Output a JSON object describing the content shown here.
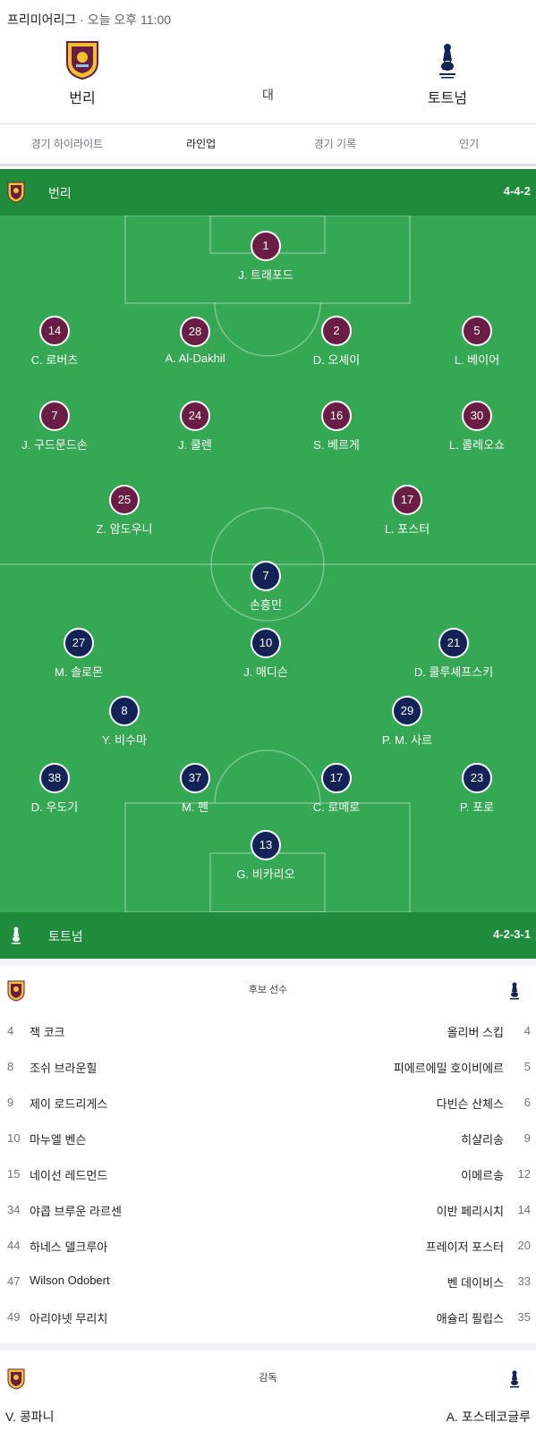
{
  "header": {
    "league": "프리미어리그",
    "time": "· 오늘 오후 11:00",
    "home_team": "번리",
    "away_team": "토트넘",
    "vs": "대"
  },
  "tabs": [
    {
      "label": "경기 하이라이트",
      "active": false
    },
    {
      "label": "라인업",
      "active": true
    },
    {
      "label": "경기 기록",
      "active": false
    },
    {
      "label": "인기",
      "active": false
    }
  ],
  "colors": {
    "pitch": "#34a852",
    "team_bar": "#1e8c3a",
    "home_kit": "#6c1d45",
    "away_kit": "#132257"
  },
  "home_lineup": {
    "team": "번리",
    "formation": "4-4-2",
    "players": [
      {
        "num": "1",
        "name": "J. 트래포드"
      },
      {
        "num": "14",
        "name": "C. 로버츠"
      },
      {
        "num": "28",
        "name": "A. Al-Dakhil"
      },
      {
        "num": "2",
        "name": "D. 오셰이"
      },
      {
        "num": "5",
        "name": "L. 베이어"
      },
      {
        "num": "7",
        "name": "J. 구드문드손"
      },
      {
        "num": "24",
        "name": "J. 쿨렌"
      },
      {
        "num": "16",
        "name": "S. 베르게"
      },
      {
        "num": "30",
        "name": "L. 콜레오쇼"
      },
      {
        "num": "25",
        "name": "Z. 암도우니"
      },
      {
        "num": "17",
        "name": "L. 포스터"
      }
    ]
  },
  "away_lineup": {
    "team": "토트넘",
    "formation": "4-2-3-1",
    "players": [
      {
        "num": "7",
        "name": "손흥민"
      },
      {
        "num": "27",
        "name": "M. 솔로몬"
      },
      {
        "num": "10",
        "name": "J. 매디슨"
      },
      {
        "num": "21",
        "name": "D. 쿨루셰프스키"
      },
      {
        "num": "8",
        "name": "Y. 비수마"
      },
      {
        "num": "29",
        "name": "P. M. 사르"
      },
      {
        "num": "38",
        "name": "D. 우도기"
      },
      {
        "num": "37",
        "name": "M. 펜"
      },
      {
        "num": "17",
        "name": "C. 로메로"
      },
      {
        "num": "23",
        "name": "P. 포로"
      },
      {
        "num": "13",
        "name": "G. 비카리오"
      }
    ]
  },
  "subs": {
    "title": "후보 선수",
    "rows": [
      {
        "home_num": "4",
        "home_name": "잭 코크",
        "away_name": "올리버 스킵",
        "away_num": "4"
      },
      {
        "home_num": "8",
        "home_name": "조쉬 브라운힐",
        "away_name": "피에르에밀 호이비에르",
        "away_num": "5"
      },
      {
        "home_num": "9",
        "home_name": "제이 로드리게스",
        "away_name": "다빈슨 산체스",
        "away_num": "6"
      },
      {
        "home_num": "10",
        "home_name": "마누엘 벤슨",
        "away_name": "히샬리송",
        "away_num": "9"
      },
      {
        "home_num": "15",
        "home_name": "네이선 레드먼드",
        "away_name": "이메르송",
        "away_num": "12"
      },
      {
        "home_num": "34",
        "home_name": "야콥 브루운 라르센",
        "away_name": "이반 페리시치",
        "away_num": "14"
      },
      {
        "home_num": "44",
        "home_name": "하네스 델크루아",
        "away_name": "프레이저 포스터",
        "away_num": "20"
      },
      {
        "home_num": "47",
        "home_name": "Wilson Odobert",
        "away_name": "벤 데이비스",
        "away_num": "33"
      },
      {
        "home_num": "49",
        "home_name": "아리야넷 무리치",
        "away_name": "애슐리 필립스",
        "away_num": "35"
      }
    ]
  },
  "coach": {
    "title": "감독",
    "home": "V. 콩파니",
    "away": "A. 포스테코글루"
  }
}
